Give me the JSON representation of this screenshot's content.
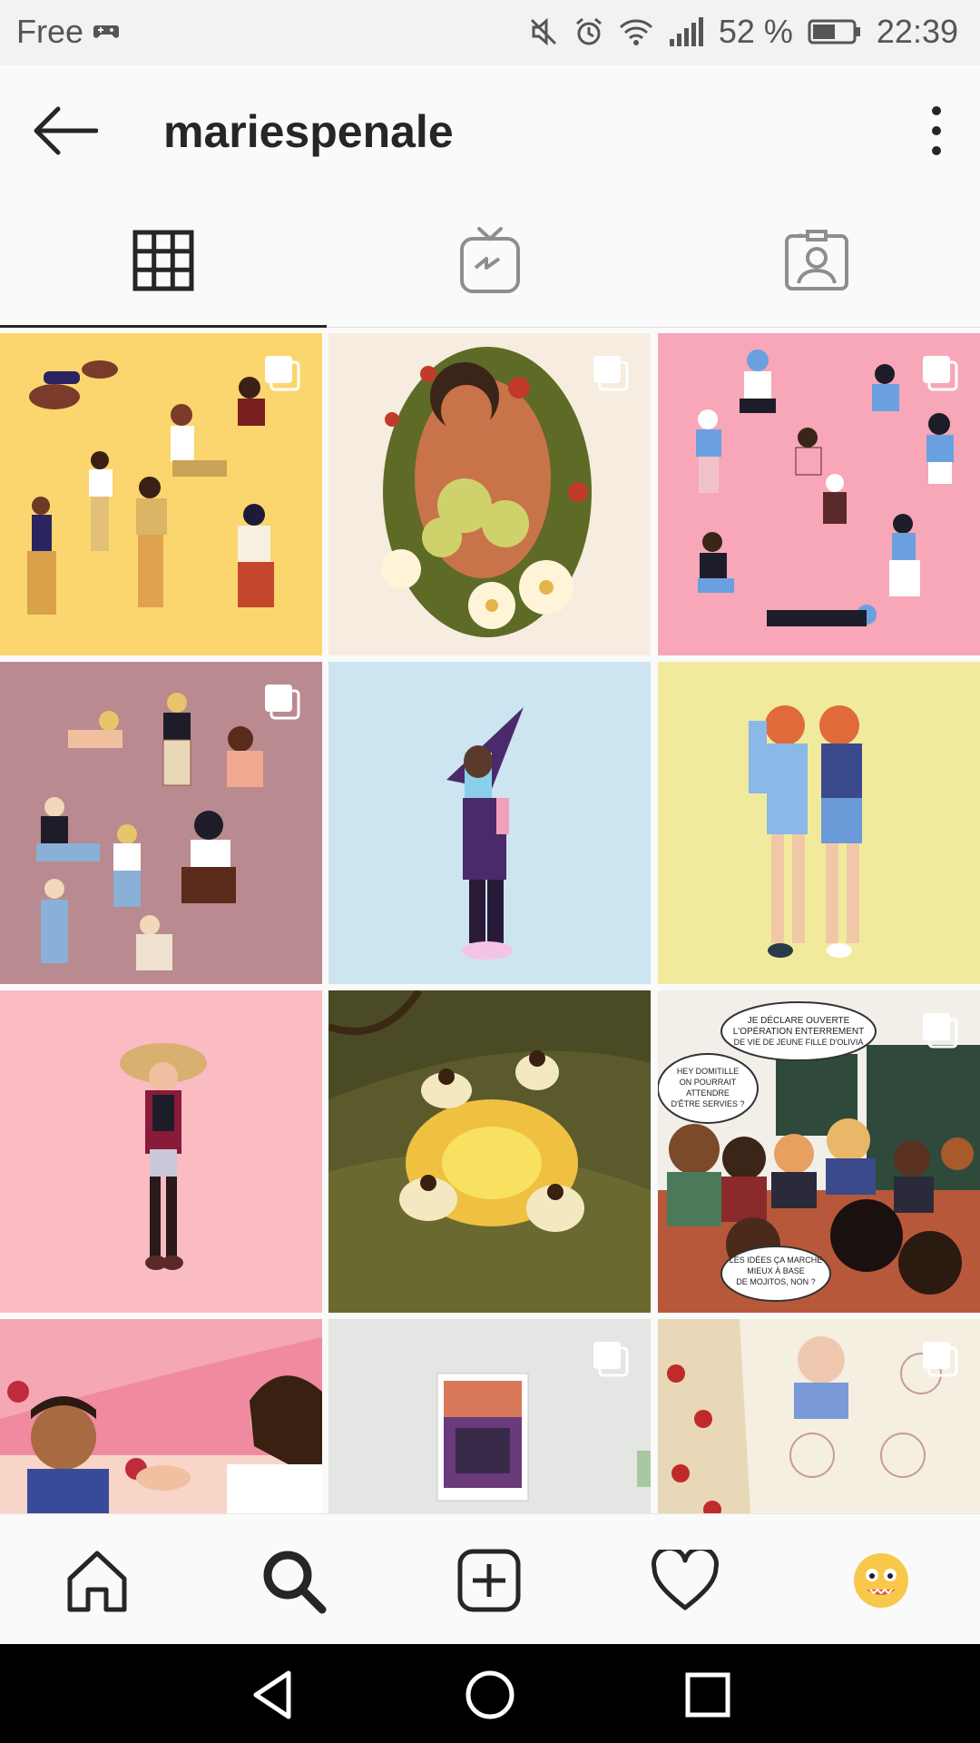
{
  "status_bar": {
    "carrier": "Free",
    "battery": "52 %",
    "time": "22:39",
    "icons": [
      "game-controller-icon",
      "mute-icon",
      "alarm-icon",
      "wifi-icon",
      "signal-icon",
      "battery-icon"
    ]
  },
  "header": {
    "username": "mariespenale",
    "back_icon": "arrow-left-icon",
    "more_icon": "more-vertical-icon"
  },
  "tabs": [
    {
      "name": "grid",
      "icon": "grid-icon",
      "active": true
    },
    {
      "name": "igtv",
      "icon": "igtv-icon",
      "active": false
    },
    {
      "name": "tagged",
      "icon": "tagged-user-icon",
      "active": false
    }
  ],
  "posts": [
    {
      "bg": "#fbd66e",
      "multi": true
    },
    {
      "bg": "#f6ecdf",
      "multi": true
    },
    {
      "bg": "#f7a7b8",
      "multi": true
    },
    {
      "bg": "#b98a8f",
      "multi": true
    },
    {
      "bg": "#cde5f1",
      "multi": false
    },
    {
      "bg": "#f1ea9d",
      "multi": false
    },
    {
      "bg": "#fbbbc2",
      "multi": false
    },
    {
      "bg": "#5a5a2c",
      "multi": false
    },
    {
      "bg": "#f1efe8",
      "multi": true
    },
    {
      "bg": "#f6a7b4",
      "multi": false
    },
    {
      "bg": "#e3e6e3",
      "multi": true
    },
    {
      "bg": "#f5efe2",
      "multi": true
    }
  ],
  "comic": {
    "bubble1": "JE DÉCLARE OUVERTE L'OPÉRATION ENTERREMENT DE VIE DE JEUNE FILLE D'OLIVIA",
    "bubble2": "HEY DOMITILLE ON POURRAIT ATTENDRE D'ÊTRE SERVIES ?",
    "bubble3": "LES IDÉES ÇA MARCHE MIEUX À BASE DE MOJITOS, NON ?"
  },
  "bottom_nav": [
    "home-icon",
    "search-icon",
    "add-post-icon",
    "heart-icon",
    "profile-avatar"
  ],
  "system_nav": [
    "back-triangle-icon",
    "home-circle-icon",
    "recents-square-icon"
  ],
  "colors": {
    "text": "#262626",
    "status_bg": "#f2f2f2",
    "divider": "#dbdbdb"
  }
}
